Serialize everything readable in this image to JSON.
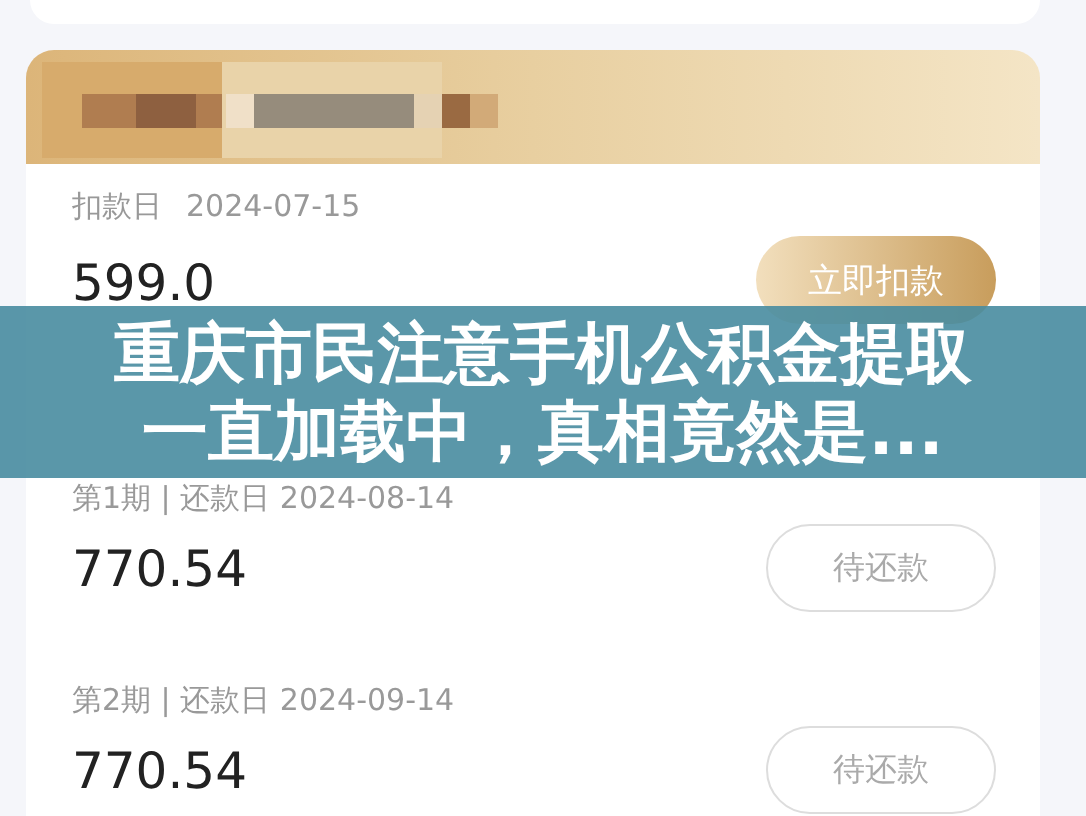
{
  "deduction": {
    "label": "扣款日",
    "date": "2024-07-15",
    "amount": "599.0",
    "button": {
      "label": "立即扣款",
      "kind": "primary"
    }
  },
  "installments": [
    {
      "label": "第1期 | 还款日 2024-08-14",
      "amount": "770.54",
      "button": {
        "label": "待还款",
        "kind": "outline"
      }
    },
    {
      "label": "第2期 | 还款日 2024-09-14",
      "amount": "770.54",
      "button": {
        "label": "待还款",
        "kind": "outline"
      }
    }
  ],
  "headline": {
    "lines": [
      "重庆市民注意手机公积金提取",
      "一直加载中，真相竟然是..."
    ]
  }
}
